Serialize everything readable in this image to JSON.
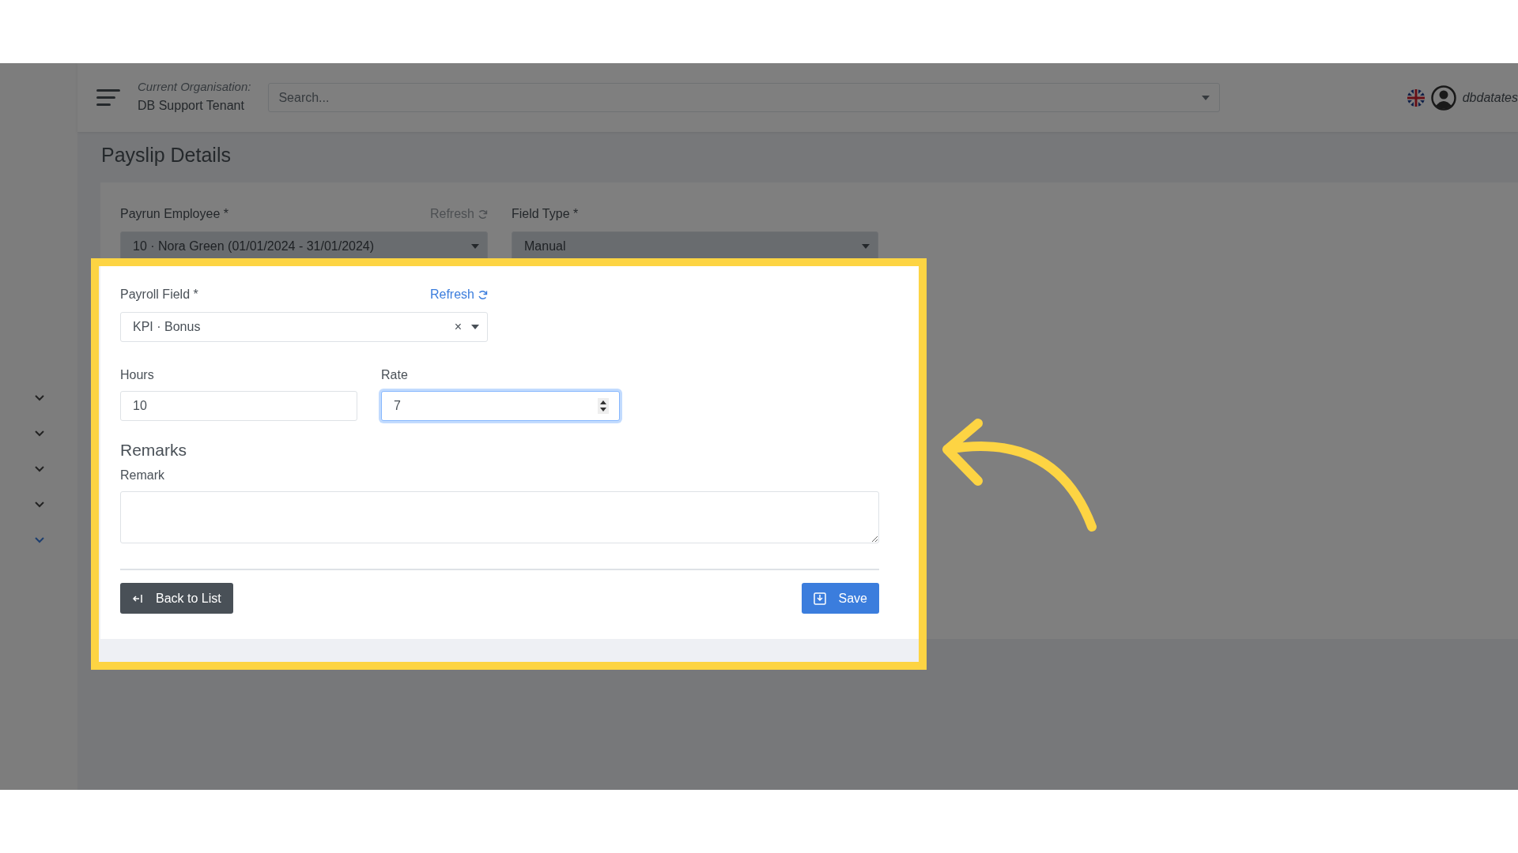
{
  "sidebar": {
    "items": [
      {
        "selected": false
      },
      {
        "selected": false
      },
      {
        "selected": false
      },
      {
        "selected": false
      },
      {
        "selected": true
      }
    ]
  },
  "header": {
    "org_label": "Current Organisation:",
    "org_name": "DB Support Tenant",
    "search": {
      "placeholder": "Search..."
    },
    "username": "dbdatates"
  },
  "page_title": "Payslip Details",
  "form": {
    "fields": [
      {
        "kind": "select",
        "label": "Payrun Employee  *",
        "value": "10 · Nora Green (01/01/2024 - 31/01/2024)",
        "disabled": true,
        "clearable": false,
        "refresh": {
          "label": "Refresh",
          "disabled": true
        }
      },
      {
        "kind": "select",
        "label": "Field Type *",
        "value": "Manual",
        "disabled": true,
        "clearable": false
      },
      {
        "kind": "select",
        "label": "Payroll Field *",
        "value": "KPI · Bonus",
        "disabled": false,
        "clearable": true,
        "clear": "×",
        "refresh": {
          "label": "Refresh",
          "disabled": false
        }
      },
      {
        "kind": "input",
        "label": "Hours",
        "value": "10",
        "focused": false
      },
      {
        "kind": "number",
        "label": "Rate",
        "value": "7",
        "focused": true
      }
    ],
    "section_title": "Remarks",
    "remark": {
      "label": "Remark"
    }
  },
  "buttons": [
    {
      "kind": "back",
      "label": "Back to List"
    },
    {
      "kind": "save",
      "label": "Save"
    }
  ]
}
